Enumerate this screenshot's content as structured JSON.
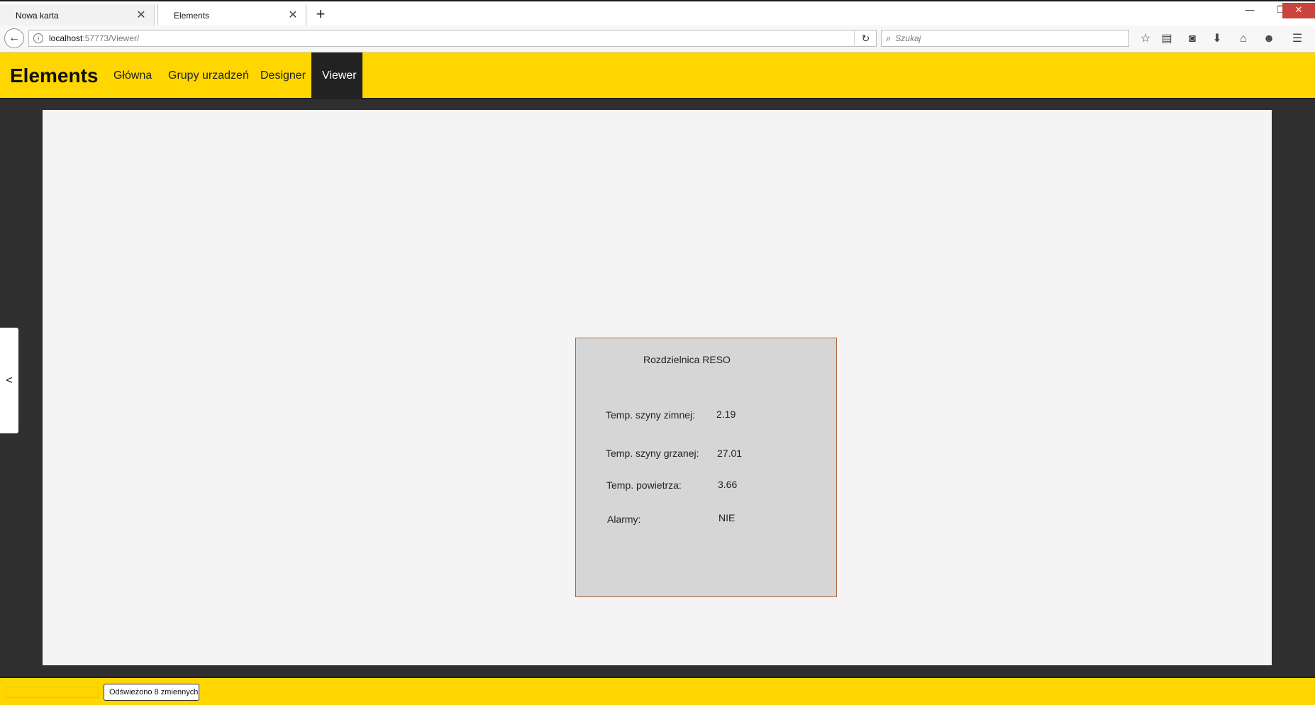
{
  "browser": {
    "tabs": [
      {
        "label": "Nowa karta"
      },
      {
        "label": "Elements"
      }
    ],
    "url_host": "localhost",
    "url_path": ":57773/Viewer/",
    "search_placeholder": "Szukaj",
    "window_controls": {
      "minimize": "—",
      "restore": "❐",
      "close": "✕"
    }
  },
  "app": {
    "brand": "Elements",
    "nav": [
      {
        "label": "Główna"
      },
      {
        "label": "Grupy urzadzeń"
      },
      {
        "label": "Designer"
      },
      {
        "label": "Viewer",
        "active": true
      }
    ]
  },
  "panel": {
    "title": "Rozdzielnica RESO",
    "rows": [
      {
        "label": "Temp. szyny zimnej:",
        "value": "2.19"
      },
      {
        "label": "Temp. szyny grzanej:",
        "value": "27.01"
      },
      {
        "label": "Temp. powietrza:",
        "value": "3.66"
      },
      {
        "label": "Alarmy:",
        "value": "NIE"
      }
    ]
  },
  "sidebar_toggle": "<",
  "footer": {
    "status": "Odświeżono 8 zmiennych"
  },
  "colors": {
    "accent": "#ffd600",
    "dark": "#2f2f2f",
    "panel_border": "#b0653a"
  }
}
